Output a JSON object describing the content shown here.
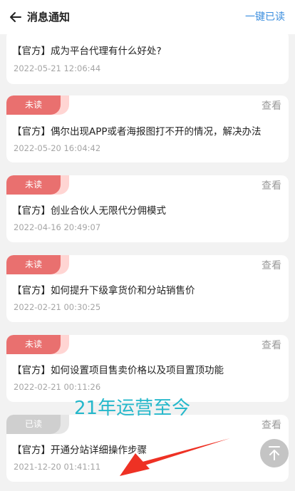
{
  "header": {
    "title": "消息通知",
    "mark_all_read": "一键已读"
  },
  "messages": [
    {
      "title": "【官方】成为平台代理有什么好处?",
      "time": "2022-05-21 12:06:44"
    },
    {
      "status": "未读",
      "view_label": "查看",
      "title": "【官方】偶尔出现APP或者海报图打不开的情况，解决办法",
      "time": "2022-05-20 16:04:42"
    },
    {
      "status": "未读",
      "view_label": "查看",
      "title": "【官方】创业合伙人无限代分佣模式",
      "time": "2022-04-16 20:49:07"
    },
    {
      "status": "未读",
      "view_label": "查看",
      "title": "【官方】如何提升下级拿货价和分站销售价",
      "time": "2022-02-21 00:30:25"
    },
    {
      "status": "未读",
      "view_label": "查看",
      "title": "【官方】如何设置项目售卖价格以及项目置顶功能",
      "time": "2022-02-21 00:11:26"
    },
    {
      "status": "已读",
      "view_label": "查看",
      "title": "【官方】开通分站详细操作步骤",
      "time": "2021-12-20 01:41:11"
    }
  ],
  "annotation": {
    "text": "21年运营至今"
  },
  "icons": {
    "back": "arrow-left-icon",
    "scroll_top": "arrow-up-to-top-icon"
  },
  "colors": {
    "accent": "#3a8dde",
    "unread_badge": "#e9706f",
    "read_badge": "#cfcfcf",
    "annotation": "#25b8cb",
    "arrow": "#ee3124"
  }
}
